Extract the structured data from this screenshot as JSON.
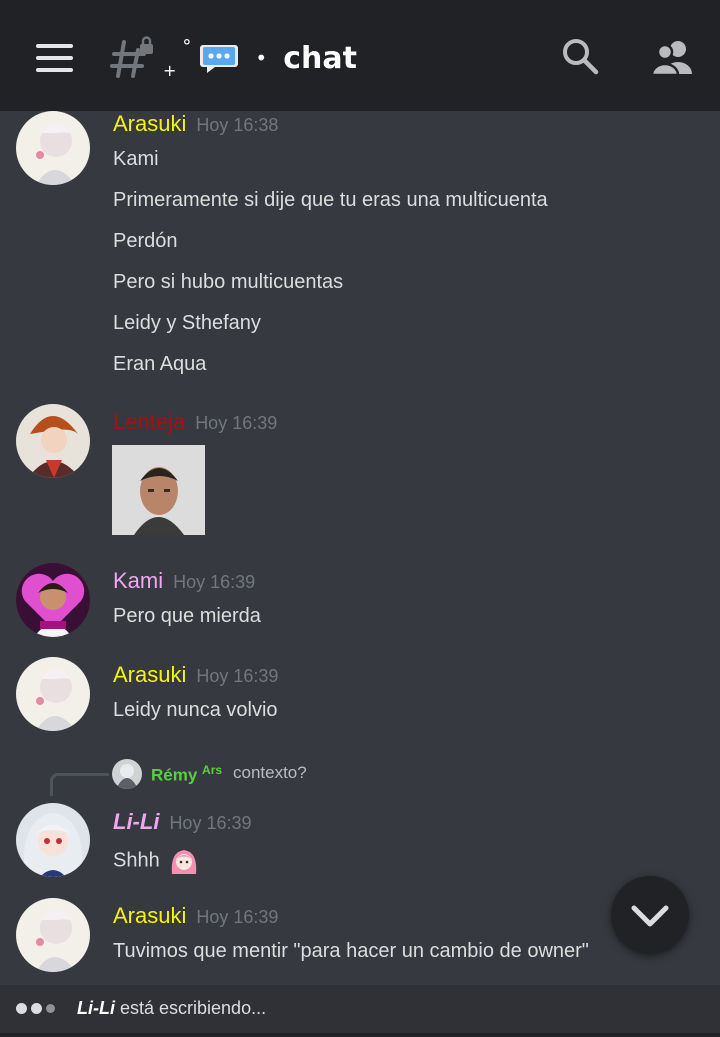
{
  "header": {
    "channel_prefix_plus": "+",
    "channel_prefix_circle": "°",
    "channel_dot": "•",
    "channel_title": "chat"
  },
  "messages": [
    {
      "author": "Arasuki",
      "author_color": "#f5f50b",
      "time": "Hoy 16:38",
      "lines": [
        "Kami",
        "Primeramente si dije que tu eras una multicuenta",
        "Perdón",
        "Pero si hubo multicuentas",
        "Leidy y Sthefany",
        "Eran Aqua"
      ]
    },
    {
      "author": "Lenteja",
      "author_color": "#a31212",
      "time": "Hoy 16:39",
      "attachment": "image"
    },
    {
      "author": "Kami",
      "author_color": "#f2a6f2",
      "time": "Hoy 16:39",
      "lines": [
        "Pero que mierda"
      ]
    },
    {
      "author": "Arasuki",
      "author_color": "#f5f50b",
      "time": "Hoy 16:39",
      "lines": [
        "Leidy nunca volvio"
      ]
    },
    {
      "reply": {
        "name": "Rémy",
        "tag": "Ars",
        "text": "contexto?"
      },
      "author": "Li-Li",
      "author_color": "#f2a6f2",
      "time": "Hoy 16:39",
      "lines": [
        "Shhh"
      ],
      "emoji": "pink-hair-girl-emoji"
    },
    {
      "author": "Arasuki",
      "author_color": "#f5f50b",
      "time": "Hoy 16:39",
      "lines": [
        "Tuvimos que mentir \"para hacer un cambio de owner\""
      ]
    }
  ],
  "typing": {
    "user": "Li-Li",
    "text": "está escribiendo..."
  },
  "colors": {
    "background": "#36393f",
    "header": "#202225",
    "typing_bar": "#2f3136",
    "muted": "#72767d"
  },
  "icons": [
    "menu-icon",
    "channel-hash-lock-icon",
    "chat-bubble-icon",
    "search-icon",
    "members-icon",
    "chevron-down-icon",
    "typing-dots-icon"
  ]
}
